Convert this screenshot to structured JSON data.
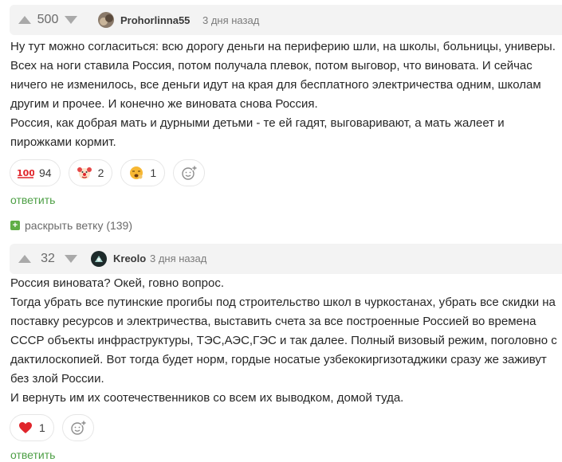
{
  "comments": [
    {
      "votes": "500",
      "username": "Prohorlinna55",
      "time": "3 дня назад",
      "lines": [
        "Ну тут можно согласиться: всю дорогу деньги на периферию шли, на школы, больницы, универы.",
        "Всех на ноги ставила Россия, потом получала плевок, потом выговор, что виновата. И сейчас",
        "ничего не изменилось, все деньги идут на края для бесплатного электричества одним, школам",
        "другим и прочее. И конечно же виновата снова Россия.",
        "Россия, как добрая мать и дурными детьми - те ей гадят, выговаривают, а мать жалеет и",
        "пирожками кормит."
      ],
      "reactions": [
        {
          "icon": "hundred-points-icon",
          "glyph": "💯",
          "count": "94"
        },
        {
          "icon": "clown-face-icon",
          "glyph": "🤡",
          "count": "2"
        },
        {
          "icon": "yawning-face-icon",
          "glyph": "🥱",
          "count": "1"
        }
      ],
      "reply": "ответить"
    },
    {
      "votes": "32",
      "username": "Kreolo",
      "time": "3 дня назад",
      "lines": [
        "Россия виновата? Окей, говно вопрос.",
        "Тогда убрать все путинские прогибы под строительство школ в чуркостанах, убрать все скидки на",
        "поставку ресурсов и электричества, выставить счета за все построенные Россией во времена",
        "СССР объекты инфраструктуры, ТЭС,АЭС,ГЭС и так далее. Полный визовый режим, поголовно с",
        "дактилоскопией. Вот тогда будет норм, гордые носатые узбекокиргизотаджики сразу же заживут",
        "без злой России.",
        "И вернуть им их соотечественников со всем их выводком, домой туда."
      ],
      "reactions": [
        {
          "icon": "red-heart-icon",
          "glyph": "❤",
          "count": "1"
        }
      ],
      "reply": "ответить"
    }
  ],
  "expand_thread": {
    "icon": "plus-box-icon",
    "glyph": "+",
    "label": "раскрыть ветку (139)"
  },
  "colors": {
    "accent_green": "#4d9f45",
    "header_bg": "#f3f3f3",
    "heart_red": "#e0252b"
  }
}
